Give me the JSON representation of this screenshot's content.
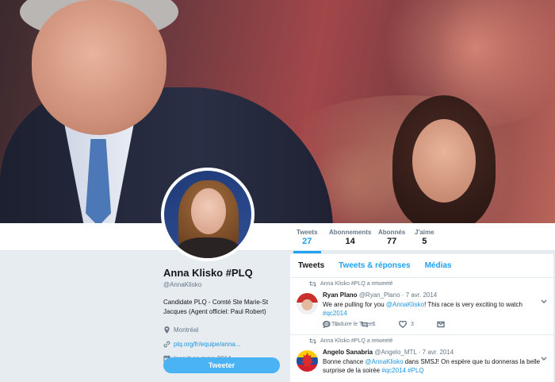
{
  "profile": {
    "name": "Anna Klisko #PLQ",
    "handle": "@AnnaKlisko",
    "bio": "Candidate PLQ - Comté Ste Marie-St Jacques (Agent officiel: Paul Robert)",
    "location": "Montréal",
    "website": "plq.org/fr/equipe/anna...",
    "joined": "Inscrit en mars 2014",
    "tweet_button": "Tweeter"
  },
  "stats": [
    {
      "label": "Tweets",
      "value": "27"
    },
    {
      "label": "Abonnements",
      "value": "14"
    },
    {
      "label": "Abonnés",
      "value": "77"
    },
    {
      "label": "J'aime",
      "value": "5"
    }
  ],
  "tabs": [
    "Tweets",
    "Tweets & réponses",
    "Médias"
  ],
  "tweets": [
    {
      "retweet_label": "Anna Klisko #PLQ a retweeté",
      "name": "Ryan Plano",
      "handle": "@Ryan_Plano",
      "date": "· 7 avr. 2014",
      "text_before": "We are pulling for you ",
      "mention": "@AnnaKlisko",
      "text_after": "! This race is very exciting to watch ",
      "hashtag": "#qc2014",
      "translate": "Traduire le Tweet",
      "reply_count": "1",
      "retweet_count": "1",
      "like_count": "3",
      "avatar_icon": "avatar-red-cap"
    },
    {
      "retweet_label": "Anna Klisko #PLQ a retweeté",
      "name": "Angelo Sanabria",
      "handle": "@Angelo_MTL",
      "date": "· 7 avr. 2014",
      "text_before": "Bonne chance ",
      "mention": "@AnnaKlisko",
      "text_after": " dans SMSJ! On espère que tu donneras la belle surprise de la soirée ",
      "hashtag": "#qc2014 #PLQ",
      "avatar_icon": "avatar-flag"
    }
  ],
  "colors": {
    "accent": "#1da1f2",
    "button": "#4ab3f4",
    "link": "#1b95e0"
  }
}
